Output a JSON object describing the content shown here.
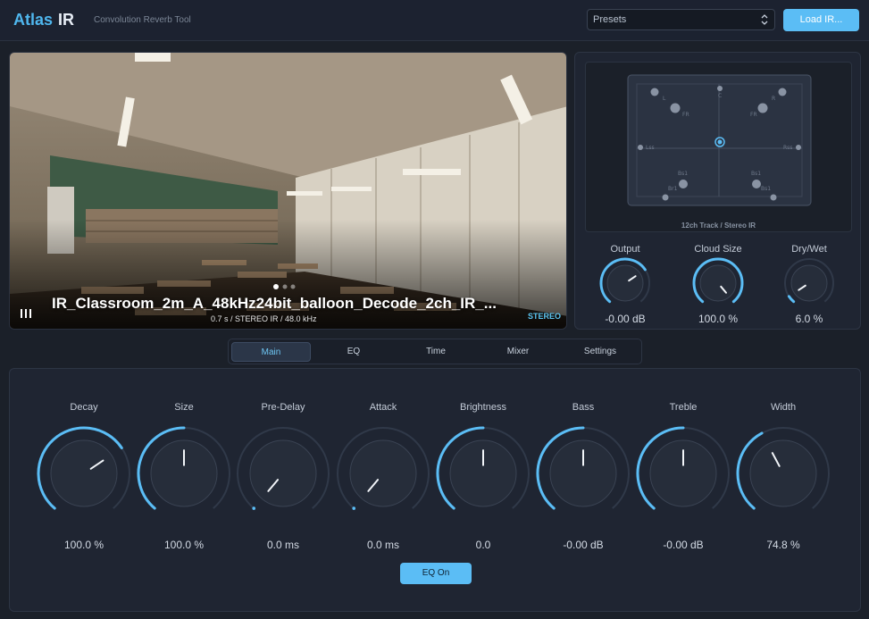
{
  "header": {
    "brand_left": "Atlas",
    "brand_right": "IR",
    "subtitle": "Convolution Reverb Tool",
    "presets_label": "Presets",
    "load_button": "Load IR..."
  },
  "ir": {
    "title": "IR_Classroom_2m_A_48kHz24bit_balloon_Decode_2ch_IR_...",
    "meta": "0.7 s  /  STEREO IR  /  48.0 kHz",
    "badge": "STEREO"
  },
  "speakers": {
    "caption": "12ch Track / Stereo IR",
    "labels": [
      "L",
      "C",
      "R",
      "FR",
      "FR",
      "Lss",
      "Rss",
      "Bs1",
      "Bs1",
      "Br1",
      "Bs1"
    ]
  },
  "right_knobs": [
    {
      "label": "Output",
      "value": "-0.00 dB",
      "level": 0.7
    },
    {
      "label": "Cloud Size",
      "value": "100.0 %",
      "level": 1.0
    },
    {
      "label": "Dry/Wet",
      "value": "6.0 %",
      "level": 0.06
    }
  ],
  "tabs": [
    "Main",
    "EQ",
    "Time",
    "Mixer",
    "Settings"
  ],
  "active_tab": "Main",
  "main_knobs": [
    {
      "label": "Decay",
      "value": "100.0 %",
      "level": 0.7
    },
    {
      "label": "Size",
      "value": "100.0 %",
      "level": 0.5
    },
    {
      "label": "Pre-Delay",
      "value": "0.0 ms",
      "level": 0.0
    },
    {
      "label": "Attack",
      "value": "0.0 ms",
      "level": 0.0
    },
    {
      "label": "Brightness",
      "value": "0.0",
      "level": 0.5
    },
    {
      "label": "Bass",
      "value": "-0.00 dB",
      "level": 0.5
    },
    {
      "label": "Treble",
      "value": "-0.00 dB",
      "level": 0.5
    },
    {
      "label": "Width",
      "value": "74.8 %",
      "level": 0.4
    }
  ],
  "eq_button": "EQ On",
  "colors": {
    "accent": "#5bbdf5",
    "background": "#1b2029",
    "panel": "#1f2532"
  }
}
